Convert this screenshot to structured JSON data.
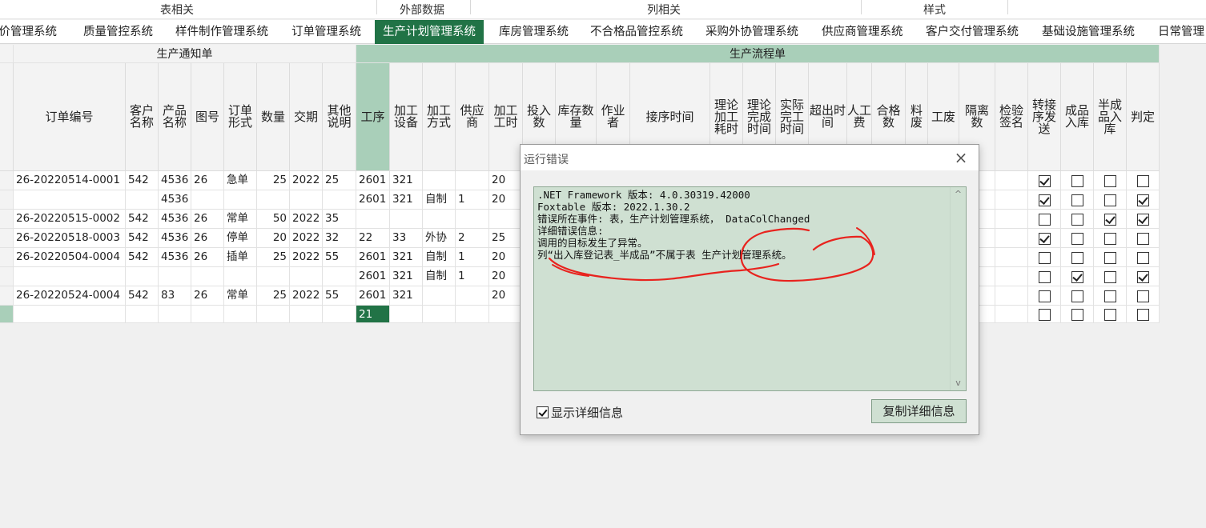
{
  "ribbon_groups": [
    "表相关",
    "外部数据",
    "列相关",
    "样式"
  ],
  "tabs": [
    "报价管理系统",
    "质量管控系统",
    "样件制作管理系统",
    "订单管理系统",
    "生产计划管理系统",
    "库房管理系统",
    "不合格品管控系统",
    "采购外协管理系统",
    "供应商管理系统",
    "客户交付管理系统",
    "基础设施管理系统",
    "日常管理"
  ],
  "active_tab": "生产计划管理系统",
  "bands": {
    "notice": "生产通知单",
    "flow": "生产流程单"
  },
  "columns": [
    "订单编号",
    "客户名称",
    "产品名称",
    "图号",
    "订单形式",
    "数量",
    "交期",
    "其他说明",
    "工序",
    "加工设备",
    "加工方式",
    "供应商",
    "加工工时",
    "投入数",
    "库存数量",
    "作业者",
    "接序时间",
    "理论加工耗时",
    "理论完成时间",
    "实际完工时间",
    "超出时间",
    "人工费",
    "合格数",
    "料废",
    "工废",
    "隔离数",
    "检验签名",
    "转接序发送",
    "成品入库",
    "半成品入库",
    "判定"
  ],
  "rows": [
    {
      "order": "26-20220514-0001",
      "cust": "542",
      "prod": "4536",
      "draw": "26",
      "form": "急单",
      "qty": "25",
      "due": "2022",
      "note": "25",
      "proc": "2601",
      "equip": "321",
      "method": "",
      "supplier": "",
      "hours": "20",
      "checks": [
        true,
        false,
        false,
        false
      ]
    },
    {
      "order": "",
      "cust": "",
      "prod": "4536",
      "draw": "",
      "form": "",
      "qty": "",
      "due": "",
      "note": "",
      "proc": "2601",
      "equip": "321",
      "method": "自制",
      "supplier": "1",
      "hours": "20",
      "checks": [
        true,
        false,
        false,
        true
      ]
    },
    {
      "order": "26-20220515-0002",
      "cust": "542",
      "prod": "4536",
      "draw": "26",
      "form": "常单",
      "qty": "50",
      "due": "2022",
      "note": "35",
      "proc": "",
      "equip": "",
      "method": "",
      "supplier": "",
      "hours": "",
      "checks": [
        false,
        false,
        true,
        true
      ]
    },
    {
      "order": "26-20220518-0003",
      "cust": "542",
      "prod": "4536",
      "draw": "26",
      "form": "停单",
      "qty": "20",
      "due": "2022",
      "note": "32",
      "proc": "22",
      "equip": "33",
      "method": "外协",
      "supplier": "2",
      "hours": "25",
      "checks": [
        true,
        false,
        false,
        false
      ]
    },
    {
      "order": "26-20220504-0004",
      "cust": "542",
      "prod": "4536",
      "draw": "26",
      "form": "插单",
      "qty": "25",
      "due": "2022",
      "note": "55",
      "proc": "2601",
      "equip": "321",
      "method": "自制",
      "supplier": "1",
      "hours": "20",
      "checks": [
        false,
        false,
        false,
        false
      ]
    },
    {
      "order": "",
      "cust": "",
      "prod": "",
      "draw": "",
      "form": "",
      "qty": "",
      "due": "",
      "note": "",
      "proc": "2601",
      "equip": "321",
      "method": "自制",
      "supplier": "1",
      "hours": "20",
      "checks": [
        false,
        true,
        false,
        true
      ]
    },
    {
      "order": "26-20220524-0004",
      "cust": "542",
      "prod": "83",
      "draw": "26",
      "form": "常单",
      "qty": "25",
      "due": "2022",
      "note": "55",
      "proc": "2601",
      "equip": "321",
      "method": "",
      "supplier": "",
      "hours": "20",
      "checks": [
        false,
        false,
        false,
        false
      ]
    },
    {
      "order": "",
      "cust": "",
      "prod": "",
      "draw": "",
      "form": "",
      "qty": "",
      "due": "",
      "note": "",
      "proc": "21",
      "equip": "",
      "method": "",
      "supplier": "",
      "hours": "",
      "checks": [
        false,
        false,
        false,
        false
      ]
    }
  ],
  "dialog": {
    "title": "运行错误",
    "close": "×",
    "detail_lines": [
      ".NET Framework 版本: 4.0.30319.42000",
      "Foxtable 版本: 2022.1.30.2",
      "错误所在事件: 表，生产计划管理系统， DataColChanged",
      "详细错误信息:",
      "调用的目标发生了异常。",
      "列“出入库登记表_半成品”不属于表 生产计划管理系统。"
    ],
    "show_details_label": "显示详细信息",
    "show_details_checked": true,
    "copy_button": "复制详细信息"
  },
  "colors": {
    "accent": "#217346",
    "header_green": "#a9cfb9",
    "annotation": "#e8231e"
  }
}
